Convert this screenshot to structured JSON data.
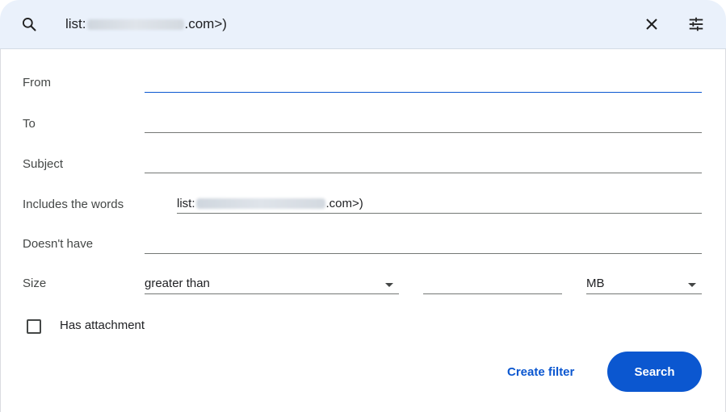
{
  "search": {
    "query_prefix": "list:",
    "query_suffix": ".com>)"
  },
  "form": {
    "from_label": "From",
    "to_label": "To",
    "subject_label": "Subject",
    "includes_label": "Includes the words",
    "includes_prefix": "list:",
    "includes_suffix": ".com>)",
    "doesnt_have_label": "Doesn't have",
    "size_label": "Size",
    "size_operator": "greater than",
    "size_unit": "MB",
    "has_attachment_label": "Has attachment"
  },
  "actions": {
    "create_filter": "Create filter",
    "search": "Search"
  },
  "colors": {
    "accent": "#0b57d0",
    "header_bg": "#eaf1fb"
  },
  "icons": [
    "search-icon",
    "close-icon",
    "tune-icon",
    "dropdown-arrow-icon",
    "checkbox-icon"
  ]
}
